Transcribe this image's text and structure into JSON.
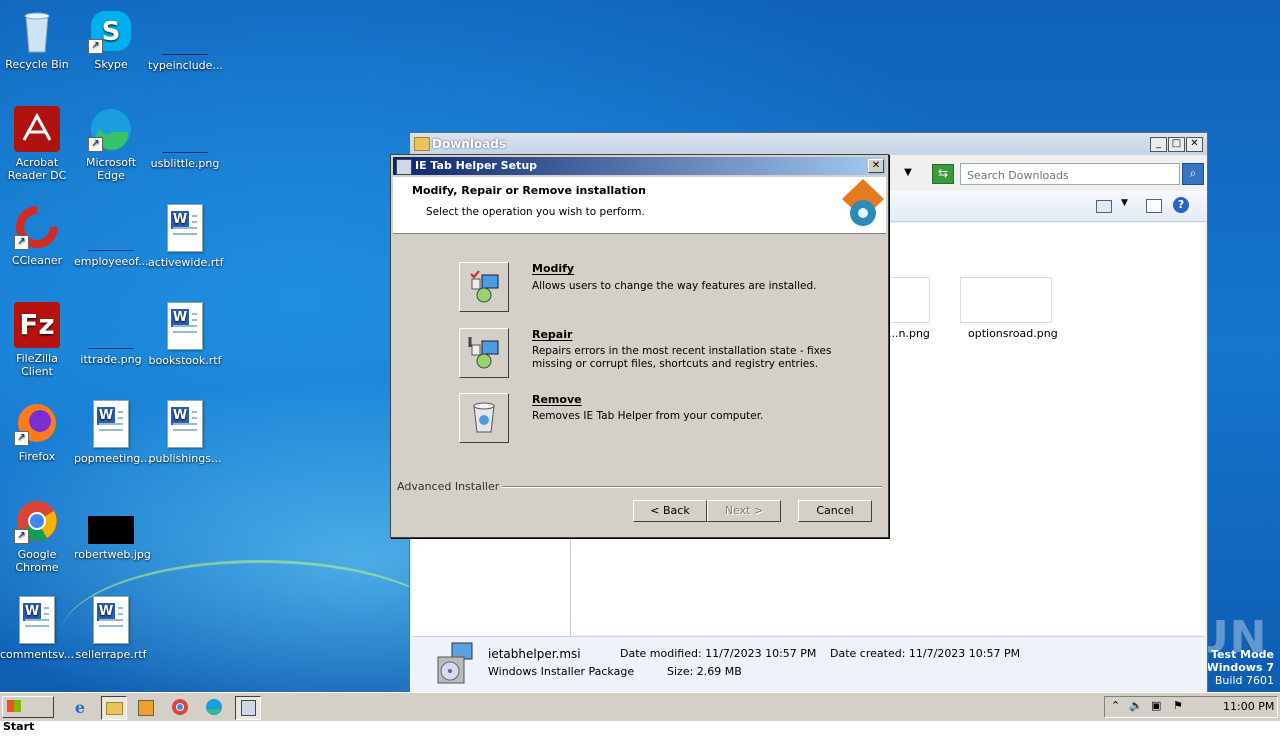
{
  "desktop": {
    "icons": [
      {
        "label": "Recycle Bin",
        "icon": "recycle-bin-icon"
      },
      {
        "label": "Skype",
        "icon": "skype-icon"
      },
      {
        "label": "typeinclude...",
        "icon": "file-icon"
      },
      {
        "label": "Acrobat Reader DC",
        "icon": "acrobat-icon"
      },
      {
        "label": "Microsoft Edge",
        "icon": "edge-icon"
      },
      {
        "label": "usblittle.png",
        "icon": "image-file-icon"
      },
      {
        "label": "CCleaner",
        "icon": "ccleaner-icon"
      },
      {
        "label": "employeeof...",
        "icon": "file-icon"
      },
      {
        "label": "activewide.rtf",
        "icon": "word-doc-icon"
      },
      {
        "label": "FileZilla Client",
        "icon": "filezilla-icon"
      },
      {
        "label": "ittrade.png",
        "icon": "image-file-icon"
      },
      {
        "label": "bookstook.rtf",
        "icon": "word-doc-icon"
      },
      {
        "label": "Firefox",
        "icon": "firefox-icon"
      },
      {
        "label": "popmeeting...",
        "icon": "word-doc-icon"
      },
      {
        "label": "publishings...",
        "icon": "word-doc-icon"
      },
      {
        "label": "Google Chrome",
        "icon": "chrome-icon"
      },
      {
        "label": "robertweb.jpg",
        "icon": "image-file-icon"
      },
      {
        "label": "commentsv...",
        "icon": "word-doc-icon"
      },
      {
        "label": "sellerrape.rtf",
        "icon": "word-doc-icon"
      }
    ],
    "watermark": {
      "brand": "ANY RUN",
      "line1": "Test Mode",
      "line2": "Windows 7",
      "line3": "Build 7601"
    }
  },
  "explorer": {
    "title": "Downloads",
    "search_placeholder": "Search Downloads",
    "files": [
      {
        "name": "...n.png"
      },
      {
        "name": "optionsroad.png"
      }
    ],
    "details": {
      "filename": "ietabhelper.msi",
      "type": "Windows Installer Package",
      "modified_label": "Date modified:",
      "modified": "11/7/2023 10:57 PM",
      "size_label": "Size:",
      "size": "2.69 MB",
      "created_label": "Date created:",
      "created": "11/7/2023 10:57 PM"
    }
  },
  "dialog": {
    "title": "IE Tab Helper Setup",
    "heading": "Modify, Repair or Remove installation",
    "subheading": "Select the operation you wish to perform.",
    "options": [
      {
        "title": "Modify",
        "desc1": "Allows users to change the way features are installed.",
        "desc2": ""
      },
      {
        "title": "Repair",
        "desc1": "Repairs errors in the most recent installation state - fixes",
        "desc2": "missing or corrupt files, shortcuts and registry entries."
      },
      {
        "title": "Remove",
        "desc1": "Removes IE Tab Helper from your computer.",
        "desc2": ""
      }
    ],
    "footer_brand": "Advanced Installer",
    "buttons": {
      "back": "< Back",
      "next": "Next >",
      "cancel": "Cancel"
    }
  },
  "taskbar": {
    "start": "Start",
    "clock": "11:00 PM"
  }
}
